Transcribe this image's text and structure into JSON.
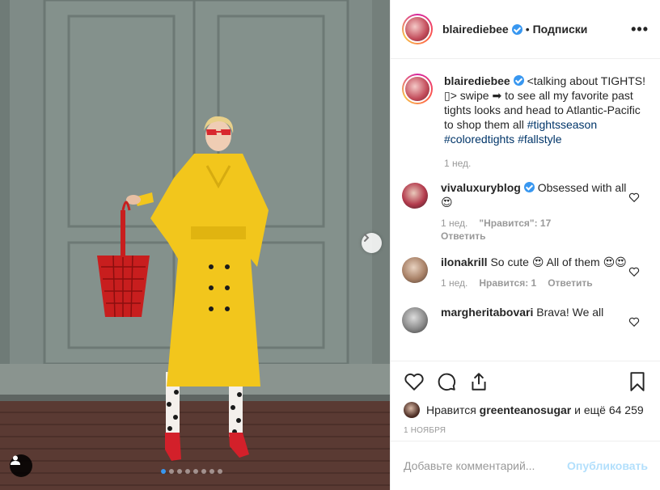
{
  "post": {
    "username": "blairediebee",
    "follow_label": "Подписки",
    "separator": "•",
    "more_label": "•••"
  },
  "caption": {
    "username": "blairediebee",
    "text_1": "<talking about TIGHTS! ",
    "glyph": "▯",
    "text_2": "> swipe ➡ to see all my favorite past tights looks and head to Atlantic-Pacific to shop them all",
    "hashtags": [
      "#tightsseason",
      "#coloredtights",
      "#fallstyle"
    ],
    "time": "1 нед."
  },
  "comments": [
    {
      "username": "vivaluxuryblog",
      "verified": true,
      "text": "Obsessed with all 😍",
      "time": "1 нед.",
      "likes": "\"Нравится\": 17",
      "reply": "Ответить"
    },
    {
      "username": "ilonakrill",
      "verified": false,
      "text": "So cute 😍 All of them 😍😍",
      "time": "1 нед.",
      "likes": "Нравится: 1",
      "reply": "Ответить"
    },
    {
      "username": "margheritabovari",
      "verified": false,
      "text": "Brava! We all",
      "time": "",
      "likes": "",
      "reply": ""
    }
  ],
  "likes": {
    "prefix": "Нравится",
    "user": "greenteanosugar",
    "suffix": "и ещё 64 259"
  },
  "date": "1 НОЯБРЯ",
  "add_comment": {
    "placeholder": "Добавьте комментарий...",
    "publish": "Опубликовать"
  },
  "carousel": {
    "count": 8,
    "active": 0
  },
  "colors": {
    "accent": "#3897f0",
    "coat": "#f0c81a",
    "bag": "#c81e1e",
    "wall": "#7d8a86"
  },
  "icons": [
    "verified-icon",
    "more-options-icon",
    "heart-icon",
    "comment-icon",
    "share-icon",
    "bookmark-icon",
    "chevron-right-icon",
    "user-tag-icon"
  ]
}
